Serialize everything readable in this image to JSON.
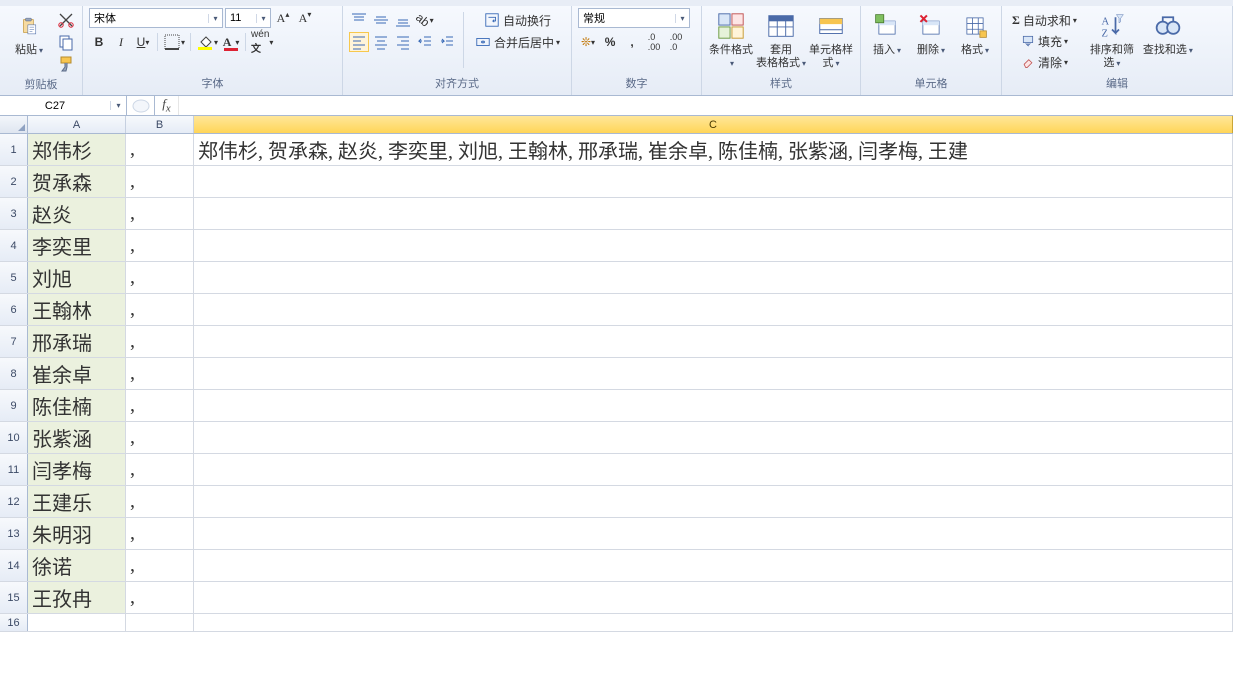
{
  "ribbon": {
    "clipboard": {
      "label": "剪贴板",
      "paste": "粘贴"
    },
    "font": {
      "label": "字体",
      "name": "宋体",
      "size": "11"
    },
    "align": {
      "label": "对齐方式",
      "wrap": "自动换行",
      "merge": "合并后居中"
    },
    "number": {
      "label": "数字",
      "format": "常规"
    },
    "styles": {
      "label": "样式",
      "cond": "条件格式",
      "table": "套用\n表格格式",
      "cell": "单元格样式"
    },
    "cells": {
      "label": "单元格",
      "insert": "插入",
      "delete": "删除",
      "format": "格式"
    },
    "editing": {
      "label": "编辑",
      "sum": "自动求和",
      "fill": "填充",
      "clear": "清除",
      "sort": "排序和筛选",
      "find": "查找和选"
    }
  },
  "namebox": "C27",
  "formula": "",
  "columns": [
    "A",
    "B",
    "C"
  ],
  "rows": [
    {
      "n": "1",
      "a": "郑伟杉",
      "b": ",",
      "c": "郑伟杉, 贺承森, 赵炎, 李奕里, 刘旭, 王翰林, 邢承瑞, 崔余卓, 陈佳楠, 张紫涵, 闫孝梅, 王建"
    },
    {
      "n": "2",
      "a": "贺承森",
      "b": ",",
      "c": ""
    },
    {
      "n": "3",
      "a": "赵炎",
      "b": ",",
      "c": ""
    },
    {
      "n": "4",
      "a": "李奕里",
      "b": ",",
      "c": ""
    },
    {
      "n": "5",
      "a": "刘旭",
      "b": ",",
      "c": ""
    },
    {
      "n": "6",
      "a": "王翰林",
      "b": ",",
      "c": ""
    },
    {
      "n": "7",
      "a": "邢承瑞",
      "b": ",",
      "c": ""
    },
    {
      "n": "8",
      "a": "崔余卓",
      "b": ",",
      "c": ""
    },
    {
      "n": "9",
      "a": "陈佳楠",
      "b": ",",
      "c": ""
    },
    {
      "n": "10",
      "a": "张紫涵",
      "b": ",",
      "c": ""
    },
    {
      "n": "11",
      "a": "闫孝梅",
      "b": ",",
      "c": ""
    },
    {
      "n": "12",
      "a": "王建乐",
      "b": ",",
      "c": ""
    },
    {
      "n": "13",
      "a": "朱明羽",
      "b": ",",
      "c": ""
    },
    {
      "n": "14",
      "a": "徐诺",
      "b": ",",
      "c": ""
    },
    {
      "n": "15",
      "a": "王孜冉",
      "b": ",",
      "c": ""
    },
    {
      "n": "16",
      "a": "",
      "b": "",
      "c": "",
      "plain": true
    }
  ]
}
